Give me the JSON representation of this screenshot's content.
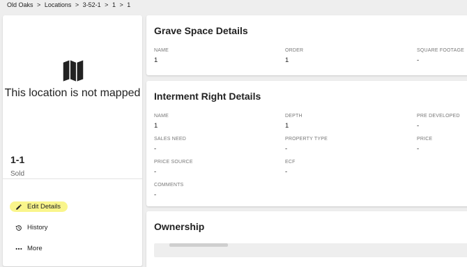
{
  "breadcrumb": [
    "Old Oaks",
    ">",
    "Locations",
    ">",
    "3-52-1",
    ">",
    "1",
    ">",
    "1"
  ],
  "left": {
    "map_message": "This location is not mapped",
    "location_name": "1-1",
    "status": "Sold",
    "actions": {
      "edit": "Edit Details",
      "history": "History",
      "more": "More"
    }
  },
  "grave_space": {
    "title": "Grave Space Details",
    "fields": [
      {
        "label": "NAME",
        "value": "1"
      },
      {
        "label": "ORDER",
        "value": "1"
      },
      {
        "label": "SQUARE FOOTAGE",
        "value": "-"
      }
    ]
  },
  "interment": {
    "title": "Interment Right Details",
    "fields": [
      {
        "label": "NAME",
        "value": "1"
      },
      {
        "label": "DEPTH",
        "value": "1"
      },
      {
        "label": "PRE DEVELOPED",
        "value": "-"
      },
      {
        "label": "SALES NEED",
        "value": "-"
      },
      {
        "label": "PROPERTY TYPE",
        "value": "-"
      },
      {
        "label": "PRICE",
        "value": "-"
      },
      {
        "label": "PRICE SOURCE",
        "value": "-"
      },
      {
        "label": "ECF",
        "value": "-"
      },
      {
        "label": "COMMENTS",
        "value": "-"
      }
    ]
  },
  "ownership": {
    "title": "Ownership"
  },
  "colors": {
    "highlight": "#f9f58c",
    "background": "#eeeeee"
  }
}
